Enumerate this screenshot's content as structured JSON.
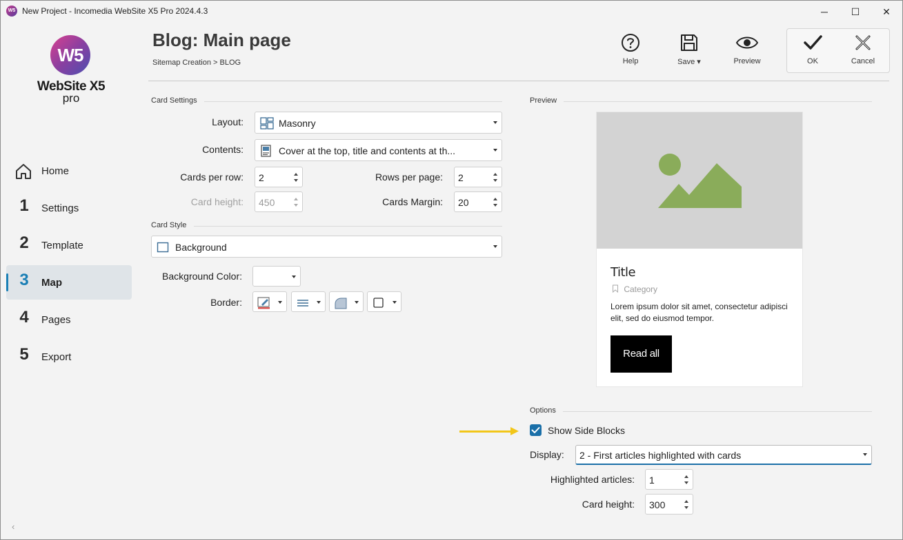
{
  "window": {
    "title": "New Project - Incomedia WebSite X5 Pro 2024.4.3",
    "minimize": "─",
    "maximize": "☐",
    "close": "✕"
  },
  "logo": {
    "mark": "W5",
    "name": "WebSite X5",
    "edition": "pro"
  },
  "nav": [
    {
      "num": "",
      "label": "Home",
      "icon": "home-icon"
    },
    {
      "num": "1",
      "label": "Settings"
    },
    {
      "num": "2",
      "label": "Template"
    },
    {
      "num": "3",
      "label": "Map",
      "active": true
    },
    {
      "num": "4",
      "label": "Pages"
    },
    {
      "num": "5",
      "label": "Export"
    }
  ],
  "header": {
    "title": "Blog: Main page",
    "breadcrumb": "Sitemap Creation > BLOG"
  },
  "toolbar": {
    "help": "Help",
    "save": "Save",
    "preview": "Preview",
    "ok": "OK",
    "cancel": "Cancel"
  },
  "card_settings": {
    "section": "Card Settings",
    "layout_label": "Layout:",
    "layout_value": "Masonry",
    "contents_label": "Contents:",
    "contents_value": "Cover at the top, title and contents at th...",
    "cards_per_row_label": "Cards per row:",
    "cards_per_row": "2",
    "rows_per_page_label": "Rows per page:",
    "rows_per_page": "2",
    "card_height_label": "Card height:",
    "card_height": "450",
    "cards_margin_label": "Cards Margin:",
    "cards_margin": "20"
  },
  "card_style": {
    "section": "Card Style",
    "style_value": "Background",
    "bg_color_label": "Background Color:",
    "border_label": "Border:"
  },
  "preview": {
    "section": "Preview",
    "title": "Title",
    "category": "Category",
    "text": "Lorem ipsum dolor sit amet, consectetur adipisci elit, sed do eiusmod tempor.",
    "button": "Read all",
    "image_bg": "#d3d3d3",
    "image_fg": "#8aac5a"
  },
  "options": {
    "section": "Options",
    "show_side_blocks_label": "Show Side Blocks",
    "show_side_blocks": true,
    "display_label": "Display:",
    "display_value": "2 - First articles highlighted with cards",
    "highlighted_label": "Highlighted articles:",
    "highlighted_value": "1",
    "card_height_label": "Card height:",
    "card_height_value": "300"
  },
  "colors": {
    "accent": "#1a7fb5",
    "checkbox": "#1a6fa8",
    "annotation_arrow": "#f2c619"
  }
}
